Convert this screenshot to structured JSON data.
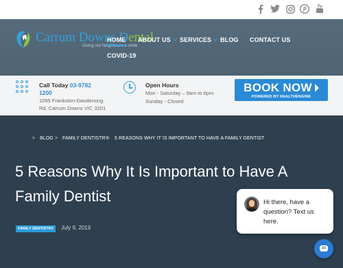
{
  "social": [
    "facebook-icon",
    "twitter-icon",
    "instagram-icon",
    "pinterest-icon",
    "youtube-icon"
  ],
  "logo": {
    "name_part1": "Carrum Downs D",
    "name_part2": "ental",
    "tagline": "Giving our Neighbours a smile"
  },
  "nav": {
    "home": "HOME",
    "about": "ABOUT US",
    "services": "SERVICES",
    "blog": "BLOG",
    "contact": "CONTACT US",
    "covid": "COVID-19"
  },
  "info": {
    "call_label": "Call Today ",
    "phone_line1": "03-9782",
    "phone_line2": "1200",
    "address_line1": "1095 Frankston-Dandenong",
    "address_line2": "Rd, Carrum Downs VIC 3201",
    "hours_title": "Open Hours",
    "hours_line1": "Mon - Saturday – 9am to 6pm",
    "hours_line2": "Sunday - Closed"
  },
  "book": {
    "label": "BOOK NOW",
    "sub": "POWERED BY HEALTHENGINE"
  },
  "breadcrumb": {
    "blog": "BLOG",
    "category": "FAMILY DENTISTRY",
    "current": "5 REASONS WHY IT IS IMPORTANT TO HAVE A FAMILY DENTIST"
  },
  "post": {
    "title": "5 Reasons Why It Is Important to Have A Family Dentist",
    "category": "FAMILY DENTISTRY",
    "date": "July 9, 2019"
  },
  "chat": {
    "message": "Hi there, have a question? Text us here."
  },
  "colors": {
    "accent": "#34a1de",
    "logo_green": "#8cc63f",
    "book_button": "#2a8ad6",
    "hero_bg": "#2e3f4f"
  }
}
